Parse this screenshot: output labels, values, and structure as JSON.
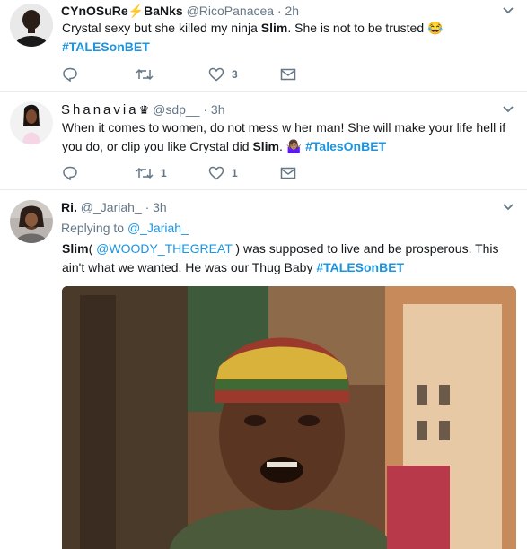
{
  "tweets": [
    {
      "name": "CYnOSuRe⚡BaNks",
      "handle": "@RicoPanacea",
      "time": "· 2h",
      "text_pre": "Crystal sexy but she killed my ninja ",
      "text_bold": "Slim",
      "text_post": ". She is not to be trusted 😂",
      "hashtag": "#TALESonBET",
      "reply_count": "",
      "retweet_count": "",
      "like_count": "3"
    },
    {
      "name": "Shanavia",
      "name_emoji": "♛",
      "handle": "@sdp__",
      "time": "· 3h",
      "text_pre": "When it comes to women, do not mess w her man! She will make your life hell if you do, or clip you like Crystal did ",
      "text_bold": "Slim",
      "text_post": ". 🤷🏽‍♀️ ",
      "hashtag": "#TalesOnBET",
      "retweet_count": "1",
      "like_count": "1"
    },
    {
      "name": "Ri.",
      "handle": "@_Jariah_",
      "time": "· 3h",
      "replying_label": "Replying to ",
      "replying_handle": "@_Jariah_",
      "text_bold": "Slim",
      "text_paren_open": "( ",
      "mention": "@WOODY_THEGREAT",
      "text_post": " ) was supposed to live and be prosperous. This ain't what we wanted. He was our Thug Baby ",
      "hashtag": "#TALESonBET"
    }
  ],
  "icons": {
    "reply": "reply-icon",
    "retweet": "retweet-icon",
    "like": "heart-icon",
    "dm": "envelope-icon",
    "more": "chevron-down-icon"
  },
  "colors": {
    "link": "#1b95e0",
    "meta": "#657786",
    "text": "#14171a",
    "divider": "#e6ecf0"
  }
}
